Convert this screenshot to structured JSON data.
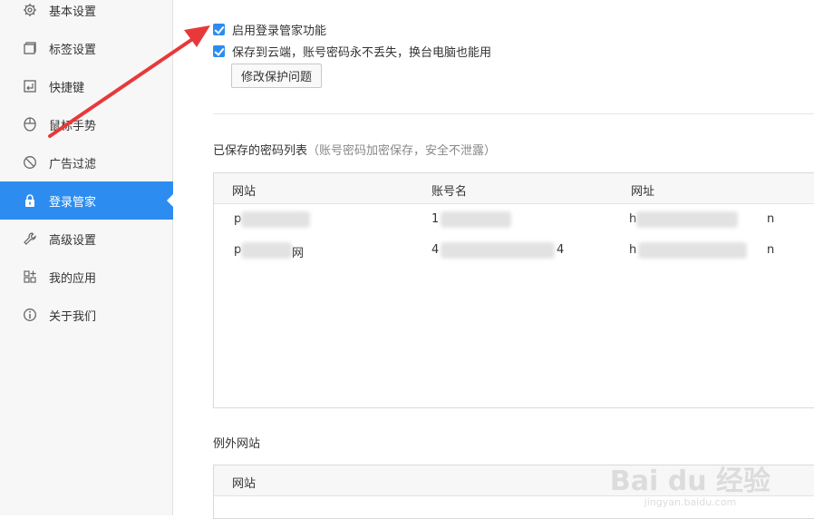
{
  "sidebar": {
    "items": [
      {
        "label": "基本设置",
        "icon": "gear-icon"
      },
      {
        "label": "标签设置",
        "icon": "tabs-icon"
      },
      {
        "label": "快捷键",
        "icon": "keyboard-icon"
      },
      {
        "label": "鼠标手势",
        "icon": "mouse-icon"
      },
      {
        "label": "广告过滤",
        "icon": "block-icon"
      },
      {
        "label": "登录管家",
        "icon": "lock-icon",
        "active": true
      },
      {
        "label": "高级设置",
        "icon": "wrench-icon"
      },
      {
        "label": "我的应用",
        "icon": "apps-icon"
      },
      {
        "label": "关于我们",
        "icon": "info-icon"
      }
    ]
  },
  "login_manager": {
    "enable_label": "启用登录管家功能",
    "enable_checked": true,
    "cloud_label": "保存到云端，账号密码永不丢失，换台电脑也能用",
    "cloud_checked": true,
    "modify_button": "修改保护问题"
  },
  "password_list": {
    "title": "已保存的密码列表",
    "hint": "（账号密码加密保存，安全不泄露）",
    "columns": [
      "网站",
      "账号名",
      "网址"
    ],
    "rows": [
      {
        "site": "p",
        "account": "1",
        "url_start": "h",
        "url_end": "n"
      },
      {
        "site": "p",
        "site_end": "网",
        "account": "4",
        "account_end": "4",
        "url_start": "h",
        "url_end": "n"
      }
    ]
  },
  "exceptions": {
    "title": "例外网站",
    "columns": [
      "网站"
    ]
  },
  "watermark": {
    "brand": "Bai du 经验",
    "domain": "jingyan.baidu.com"
  },
  "colors": {
    "accent": "#2d8cf0",
    "arrow": "#e8393a"
  }
}
